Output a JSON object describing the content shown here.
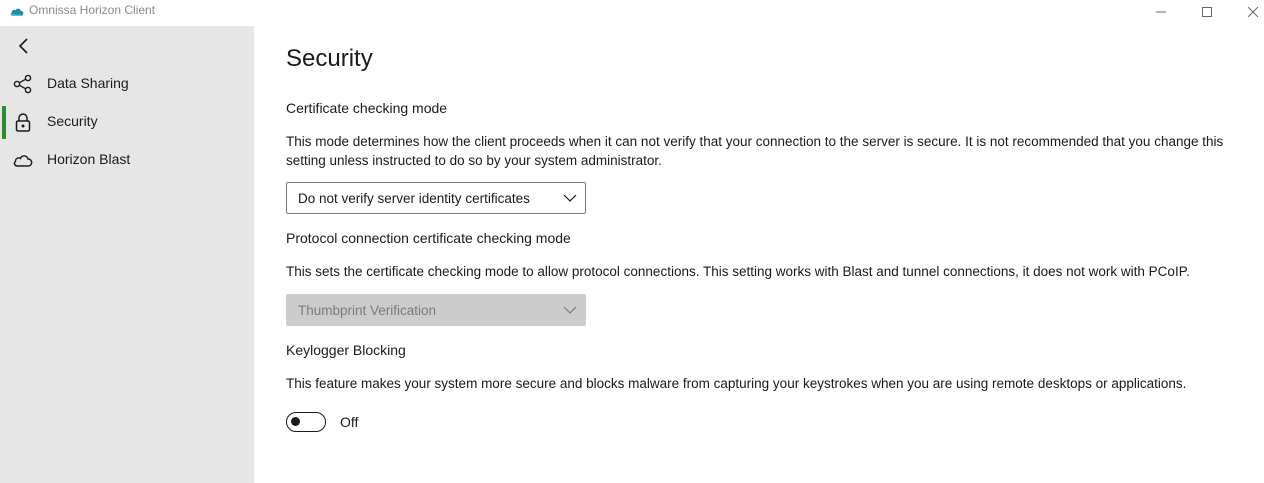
{
  "window": {
    "title": "Omnissa Horizon Client",
    "icon": "cloud-logo-icon",
    "controls": [
      "minimize-icon",
      "maximize-icon",
      "close-icon"
    ]
  },
  "sidebar": {
    "back_icon": "back-arrow-icon",
    "items": [
      {
        "label": "Data Sharing",
        "icon": "share-icon",
        "active": false
      },
      {
        "label": "Security",
        "icon": "lock-icon",
        "active": true
      },
      {
        "label": "Horizon Blast",
        "icon": "cloud-icon",
        "active": false
      }
    ]
  },
  "main": {
    "title": "Security",
    "certificate": {
      "heading": "Certificate checking mode",
      "description": "This mode determines how the client proceeds when it can not verify that your connection to the server is secure. It is not recommended that you change this setting unless instructed to do so by your system administrator.",
      "selected": "Do not verify server identity certificates"
    },
    "protocol": {
      "heading": "Protocol connection certificate checking mode",
      "description": "This sets the certificate checking mode to allow protocol connections. This setting works with Blast and tunnel connections, it does not work with PCoIP.",
      "selected": "Thumbprint Verification",
      "disabled": true
    },
    "keylogger": {
      "heading": "Keylogger Blocking",
      "description": "This feature makes your system more secure and blocks malware from capturing your keystrokes when you are using remote desktops or applications.",
      "toggle_label": "Off",
      "enabled": false
    }
  },
  "colors": {
    "accent": "#2e8b2e",
    "sidebar_bg": "#e6e6e6",
    "disabled_bg": "#cccccc",
    "logo_teal": "#1f8fa8"
  }
}
